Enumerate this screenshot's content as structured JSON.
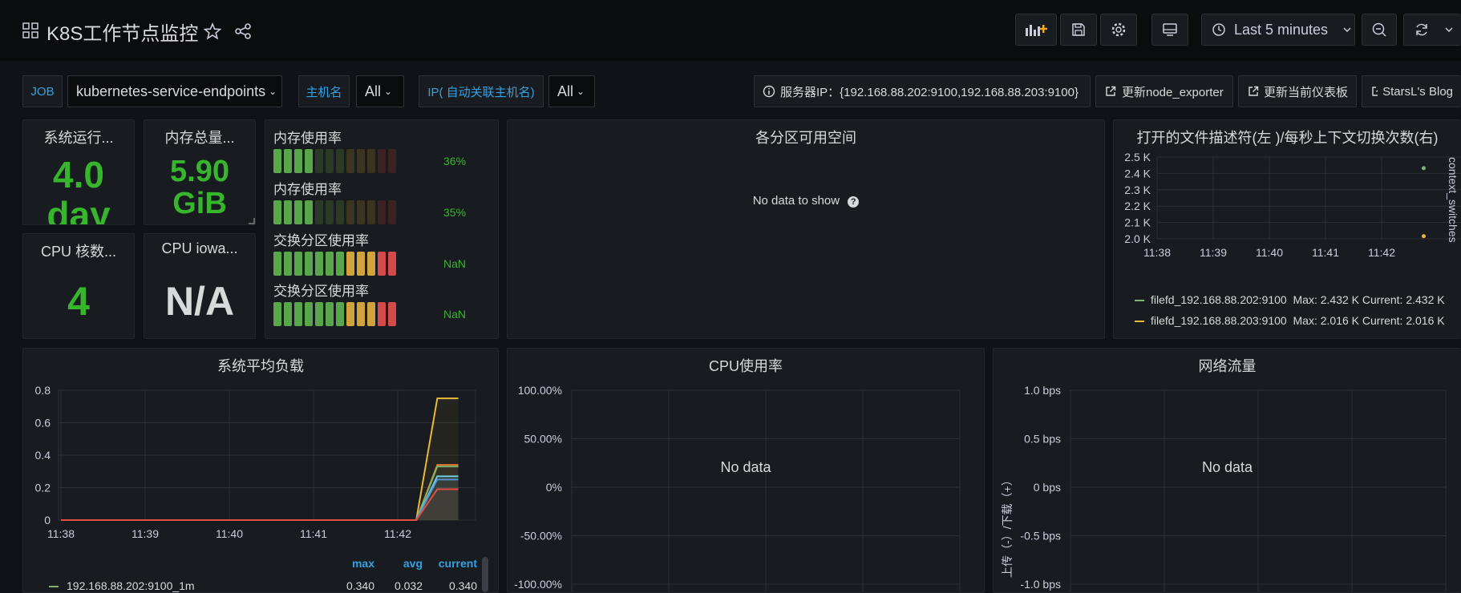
{
  "header": {
    "title": "K8S工作节点监控",
    "time_range": "Last 5 minutes"
  },
  "variables": {
    "job_label": "JOB",
    "job_value": "kubernetes-service-endpoints",
    "host_label": "主机名",
    "host_value": "All",
    "ip_label": "IP( 自动关联主机名)",
    "ip_value": "All",
    "server_ip": "服务器IP：{192.168.88.202:9100,192.168.88.203:9100}",
    "link_node_exporter": "更新node_exporter",
    "link_dashboard": "更新当前仪表板",
    "link_blog": "StarsL's Blog"
  },
  "stats": {
    "uptime": {
      "title": "系统运行...",
      "value": "4.0",
      "unit": "day"
    },
    "mem_total": {
      "title": "内存总量...",
      "value": "5.90",
      "unit": "GiB"
    },
    "cpu_cores": {
      "title": "CPU 核数...",
      "value": "4"
    },
    "cpu_iowait": {
      "title": "CPU iowa...",
      "value": "N/A"
    }
  },
  "gauges": [
    {
      "title": "内存使用率",
      "value_text": "36%",
      "value": 36
    },
    {
      "title": "内存使用率",
      "value_text": "35%",
      "value": 35
    },
    {
      "title": "交换分区使用率",
      "value_text": "NaN",
      "value": 100
    },
    {
      "title": "交换分区使用率",
      "value_text": "NaN",
      "value": 100
    }
  ],
  "partitions": {
    "title": "各分区可用空间",
    "no_data": "No data to show"
  },
  "filefd": {
    "title": "打开的文件描述符(左 )/每秒上下文切换次数(右)",
    "right_axis_label": "context_switches",
    "legend": [
      {
        "name": "filefd_192.168.88.202:9100",
        "stats": "Max: 2.432 K  Current: 2.432 K",
        "color": "#7eb26d"
      },
      {
        "name": "filefd_192.168.88.203:9100",
        "stats": "Max: 2.016 K  Current: 2.016 K",
        "color": "#eab839"
      }
    ]
  },
  "load": {
    "title": "系统平均负载",
    "legend_headers": [
      "max",
      "avg",
      "current"
    ],
    "legend_row": {
      "name": "192.168.88.202:9100_1m",
      "max": "0.340",
      "avg": "0.032",
      "current": "0.340",
      "color": "#7eb26d"
    }
  },
  "cpu": {
    "title": "CPU使用率",
    "no_data": "No data"
  },
  "network": {
    "title": "网络流量",
    "no_data": "No data",
    "ylabel": "上传（-）/下载（+）"
  },
  "colors": {
    "green": "#37b52d",
    "blue": "#33a2e5",
    "bg": "#111217",
    "panel": "#181b1f"
  },
  "chart_data": [
    {
      "type": "scatter",
      "id": "filefd",
      "x": [
        "11:38",
        "11:39",
        "11:40",
        "11:41",
        "11:42"
      ],
      "yticks": [
        "2.0 K",
        "2.1 K",
        "2.2 K",
        "2.3 K",
        "2.4 K",
        "2.5 K"
      ],
      "ylim": [
        2000,
        2500
      ],
      "series": [
        {
          "name": "filefd_192.168.88.202:9100",
          "points": [
            [
              4.75,
              2432
            ]
          ],
          "color": "#7eb26d"
        },
        {
          "name": "filefd_192.168.88.203:9100",
          "points": [
            [
              4.75,
              2016
            ]
          ],
          "color": "#eab839"
        }
      ]
    },
    {
      "type": "line",
      "id": "load",
      "x": [
        "11:38",
        "11:39",
        "11:40",
        "11:41",
        "11:42"
      ],
      "yticks": [
        "0",
        "0.2",
        "0.4",
        "0.6",
        "0.8"
      ],
      "ylim": [
        0,
        0.8
      ],
      "series": [
        {
          "color": "#eab839",
          "values": [
            [
              0,
              0
            ],
            [
              4.22,
              0
            ],
            [
              4.47,
              0.75
            ],
            [
              4.72,
              0.75
            ]
          ]
        },
        {
          "color": "#e0752d",
          "values": [
            [
              0,
              0
            ],
            [
              4.22,
              0
            ],
            [
              4.47,
              0.34
            ],
            [
              4.72,
              0.34
            ]
          ]
        },
        {
          "color": "#7eb26d",
          "values": [
            [
              0,
              0
            ],
            [
              4.22,
              0
            ],
            [
              4.47,
              0.33
            ],
            [
              4.72,
              0.33
            ]
          ]
        },
        {
          "color": "#6ed0e0",
          "values": [
            [
              0,
              0
            ],
            [
              4.22,
              0
            ],
            [
              4.47,
              0.27
            ],
            [
              4.72,
              0.27
            ]
          ]
        },
        {
          "color": "#5195ce",
          "values": [
            [
              0,
              0
            ],
            [
              4.22,
              0
            ],
            [
              4.47,
              0.25
            ],
            [
              4.72,
              0.25
            ]
          ]
        },
        {
          "color": "#e24d42",
          "values": [
            [
              0,
              0
            ],
            [
              4.22,
              0
            ],
            [
              4.47,
              0.19
            ],
            [
              4.72,
              0.19
            ]
          ]
        }
      ]
    },
    {
      "type": "line",
      "id": "cpu",
      "yticks": [
        "100.00%",
        "50.00%",
        "0%",
        "-50.00%",
        "-100.00%"
      ],
      "ylim": [
        -100,
        100
      ]
    },
    {
      "type": "line",
      "id": "network",
      "yticks": [
        "1.0 bps",
        "0.5 bps",
        "0 bps",
        "-0.5 bps",
        "-1.0 bps"
      ],
      "ylim": [
        -1,
        1
      ]
    }
  ]
}
